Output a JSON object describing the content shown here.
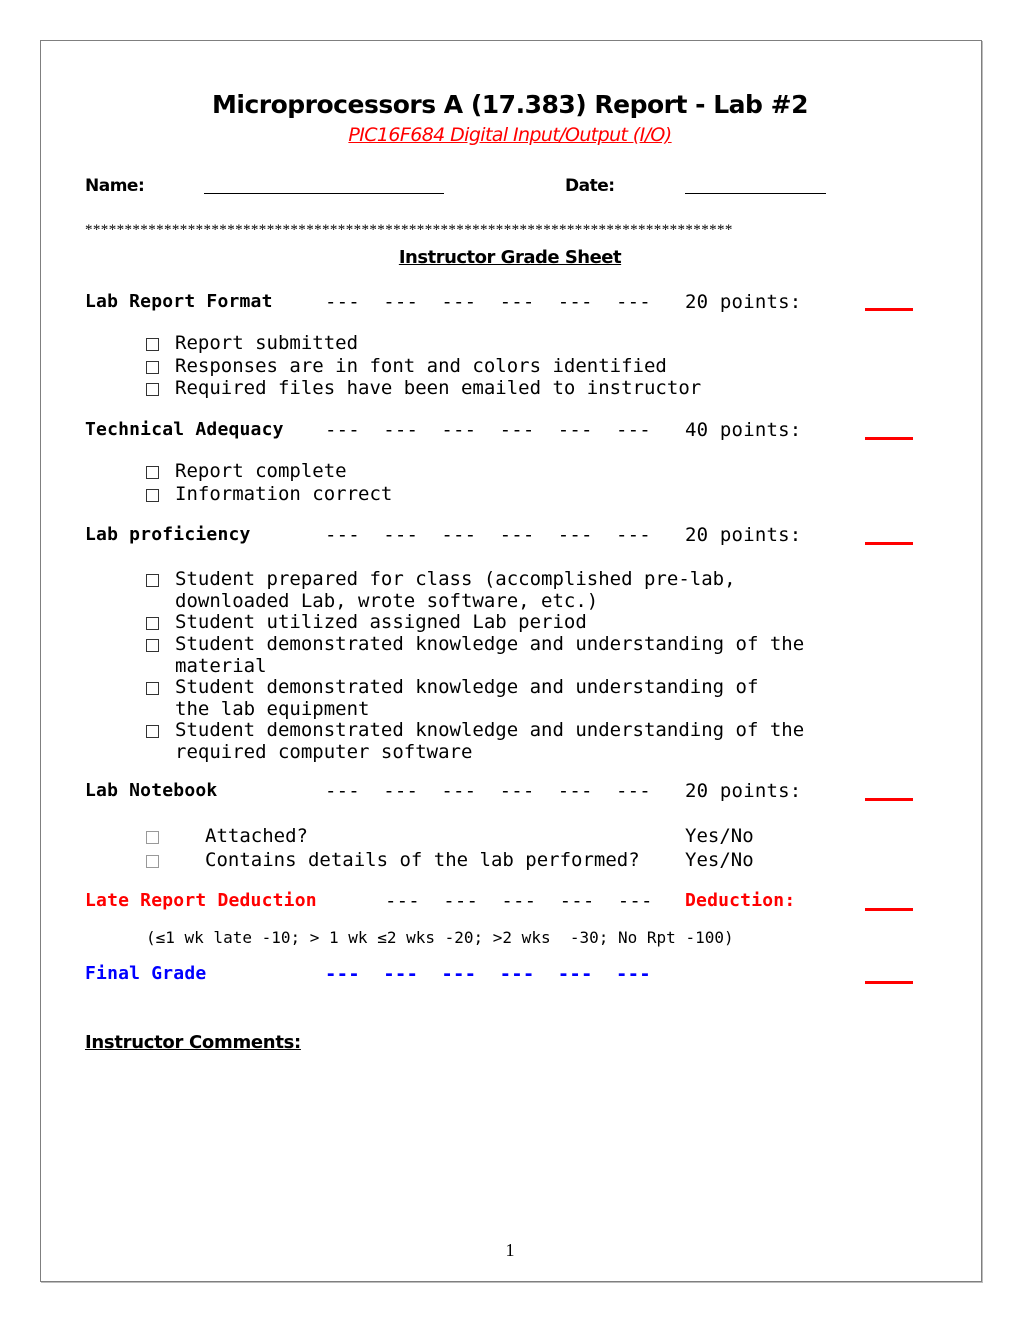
{
  "header": {
    "title": "Microprocessors A (17.383) Report - Lab #2",
    "subtitle": "PIC16F684 Digital Input/Output (I/O)"
  },
  "fields": {
    "name_label": "Name:",
    "date_label": "Date:"
  },
  "separator": "**********************************************************************************",
  "grade_sheet_title": "Instructor Grade Sheet",
  "dashes": "---  ---  ---  ---  ---  ---",
  "dashes5": "---  ---  ---  ---  ---",
  "sections": [
    {
      "label": "Lab Report Format",
      "points": "20 points:",
      "items": [
        "Report submitted",
        "Responses are in font and colors identified",
        "Required files have been emailed to instructor"
      ]
    },
    {
      "label": "Technical Adequacy",
      "points": "40 points:",
      "items": [
        "Report complete",
        "Information correct"
      ]
    },
    {
      "label": "Lab proficiency",
      "points": "20 points:",
      "items": [
        {
          "line1": "Student prepared for class (accomplished pre-lab,",
          "line2": "downloaded Lab, wrote software, etc.)"
        },
        {
          "line1": "Student utilized assigned Lab period"
        },
        {
          "line1": "Student demonstrated knowledge and understanding of the",
          "line2": "material"
        },
        {
          "line1": "Student demonstrated knowledge and understanding of",
          "line2": "the lab equipment"
        },
        {
          "line1": "Student demonstrated knowledge and understanding of the",
          "line2": "required computer software"
        }
      ]
    },
    {
      "label": "Lab Notebook",
      "points": "20 points:",
      "items": [
        {
          "question": "Attached?",
          "answer": "Yes/No"
        },
        {
          "question": "Contains details of the lab performed?",
          "answer": "Yes/No"
        }
      ]
    }
  ],
  "late": {
    "label": "Late Report Deduction",
    "points": "Deduction:",
    "note": "(≤1 wk late -10; > 1 wk ≤2 wks -20; >2 wks  -30; No Rpt -100)"
  },
  "final": {
    "label": "Final Grade"
  },
  "comments_label": "Instructor Comments:",
  "page_number": "1",
  "colors": {
    "accent_red": "#ff0000",
    "accent_blue": "#0000ff"
  }
}
